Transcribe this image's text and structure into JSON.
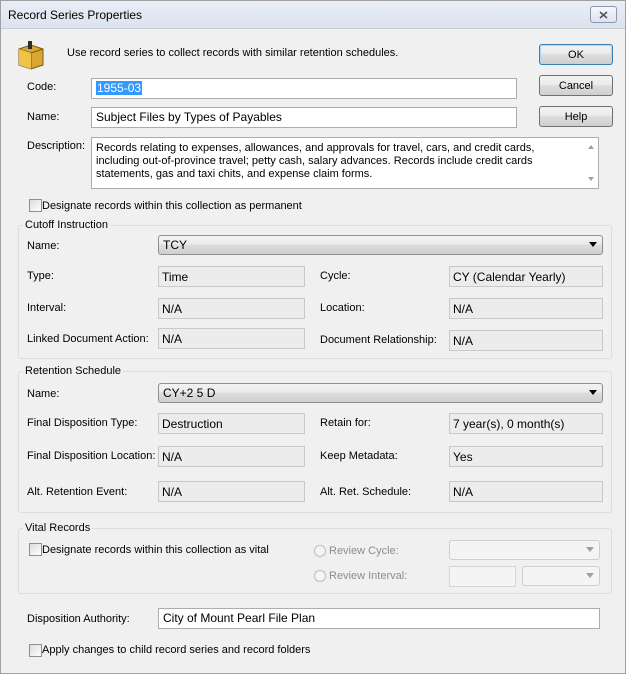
{
  "window": {
    "title": "Record Series Properties"
  },
  "intro_text": "Use record series to collect records with similar retention schedules.",
  "buttons": {
    "ok": "OK",
    "cancel": "Cancel",
    "help": "Help"
  },
  "code": {
    "label": "Code:",
    "value": "1955-03"
  },
  "name": {
    "label": "Name:",
    "value": "Subject Files by Types of Payables"
  },
  "description": {
    "label": "Description:",
    "value": "Records relating to expenses, allowances, and approvals for travel, cars, and credit cards, including out-of-province travel; petty cash, salary advances.  Records include credit cards statements, gas and taxi chits, and expense claim forms."
  },
  "permanent_checkbox": {
    "label": "Designate records within this collection as permanent",
    "checked": false
  },
  "cutoff": {
    "title": "Cutoff Instruction",
    "name_label": "Name:",
    "name_value": "TCY",
    "type_label": "Type:",
    "type_value": "Time",
    "cycle_label": "Cycle:",
    "cycle_value": "CY (Calendar Yearly)",
    "interval_label": "Interval:",
    "interval_value": "N/A",
    "location_label": "Location:",
    "location_value": "N/A",
    "linked_label": "Linked Document Action:",
    "linked_value": "N/A",
    "relationship_label": "Document Relationship:",
    "relationship_value": "N/A"
  },
  "retention": {
    "title": "Retention Schedule",
    "name_label": "Name:",
    "name_value": "CY+2 5 D",
    "final_type_label": "Final Disposition Type:",
    "final_type_value": "Destruction",
    "retain_label": "Retain for:",
    "retain_value": "7 year(s), 0 month(s)",
    "final_location_label": "Final Disposition Location:",
    "final_location_value": "N/A",
    "keep_meta_label": "Keep Metadata:",
    "keep_meta_value": "Yes",
    "alt_event_label": "Alt. Retention Event:",
    "alt_event_value": "N/A",
    "alt_schedule_label": "Alt. Ret. Schedule:",
    "alt_schedule_value": "N/A"
  },
  "vital": {
    "title": "Vital Records",
    "checkbox_label": "Designate records within this collection as vital",
    "checked": false,
    "review_cycle_label": "Review Cycle:",
    "review_interval_label": "Review Interval:"
  },
  "disposition": {
    "label": "Disposition Authority:",
    "value": "City of Mount Pearl File Plan"
  },
  "apply_checkbox": {
    "label": "Apply changes to child record series and record folders",
    "checked": false
  }
}
